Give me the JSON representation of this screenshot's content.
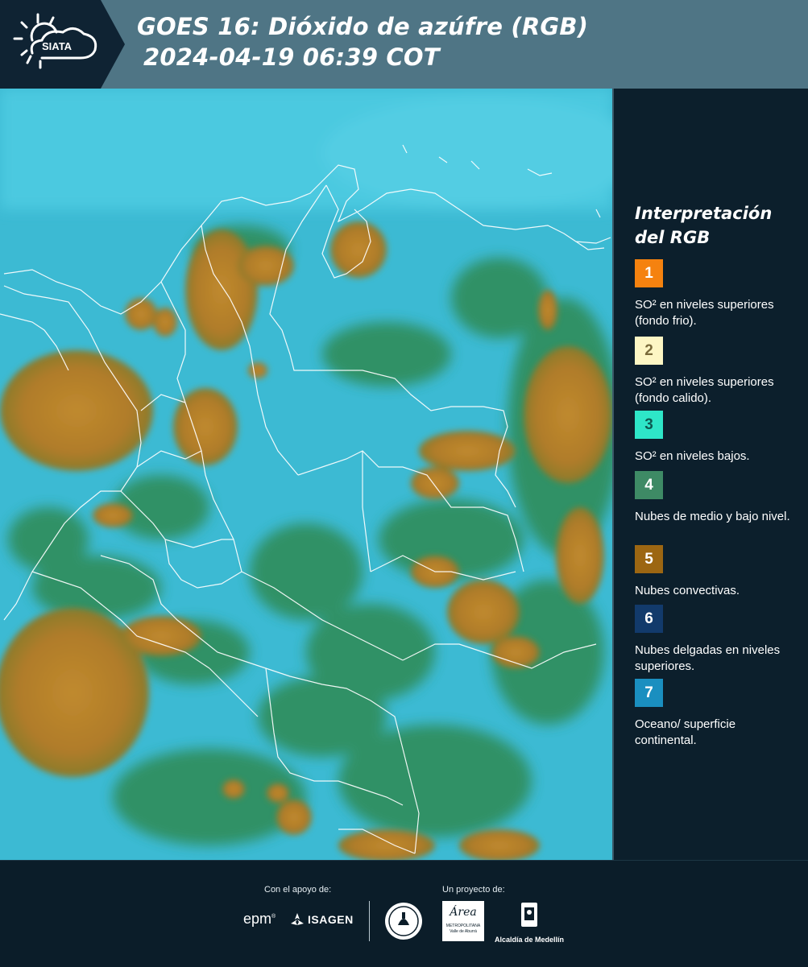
{
  "header": {
    "logo_text": "SIATA",
    "title_line1": "GOES 16: Dióxido de azúfre (RGB)",
    "title_line2": "2024-04-19 06:39 COT"
  },
  "legend": {
    "title_line1": "Interpretación",
    "title_line2": "del RGB",
    "items": [
      {
        "number": "1",
        "color": "#f5820f",
        "text": "SO² en niveles superiores (fondo frio)."
      },
      {
        "number": "2",
        "color": "#fdf6c4",
        "text": "SO² en niveles superiores (fondo calido)."
      },
      {
        "number": "3",
        "color": "#2ee6c8",
        "text": "SO² en niveles bajos."
      },
      {
        "number": "4",
        "color": "#3e8a65",
        "text": "Nubes de medio y bajo nivel."
      },
      {
        "number": "5",
        "color": "#9c6612",
        "text": "Nubes convectivas."
      },
      {
        "number": "6",
        "color": "#123a6b",
        "text": "Nubes delgadas en niveles superiores."
      },
      {
        "number": "7",
        "color": "#1a8fc0",
        "text": "Oceano/ superficie continental."
      }
    ]
  },
  "footer": {
    "support_label": "Con el apoyo de:",
    "project_label": "Un proyecto de:",
    "epm_logo": "epm",
    "isagen_logo": "ISAGEN",
    "area_logo_text": "Área",
    "area_sub1": "METROPOLITANA",
    "area_sub2": "Valle de Aburrá",
    "alcaldia_text": "Alcaldía de Medellín"
  }
}
